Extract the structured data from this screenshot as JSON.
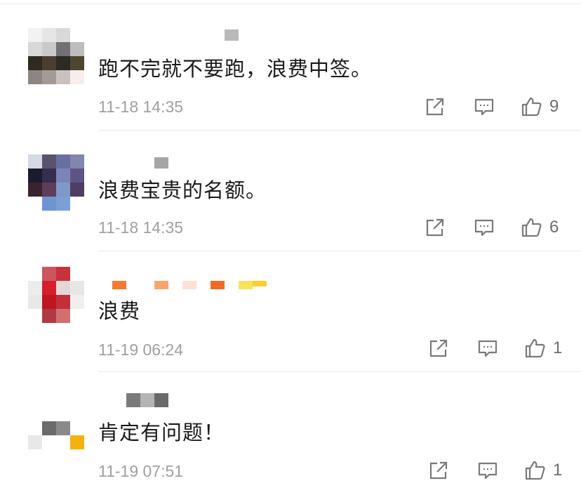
{
  "comments": [
    {
      "text": "跑不完就不要跑，浪费中签。",
      "time": "11-18 14:35",
      "likes": "9",
      "icons": [
        "share-icon",
        "comment-icon",
        "thumbs-up-icon"
      ]
    },
    {
      "text": "浪费宝贵的名额。",
      "time": "11-18 14:35",
      "likes": "6",
      "icons": [
        "share-icon",
        "comment-icon",
        "thumbs-up-icon"
      ]
    },
    {
      "text": "浪费",
      "time": "11-19 06:24",
      "likes": "1",
      "icons": [
        "share-icon",
        "comment-icon",
        "thumbs-up-icon"
      ]
    },
    {
      "text": "肯定有问题！",
      "time": "11-19 07:51",
      "likes": "1",
      "icons": [
        "share-icon",
        "comment-icon",
        "thumbs-up-icon"
      ]
    }
  ],
  "colors": {
    "text": "#1a1a1a",
    "meta": "#a0a0a0",
    "icon": "#7a7a7a",
    "divider": "#e9e9e9"
  }
}
